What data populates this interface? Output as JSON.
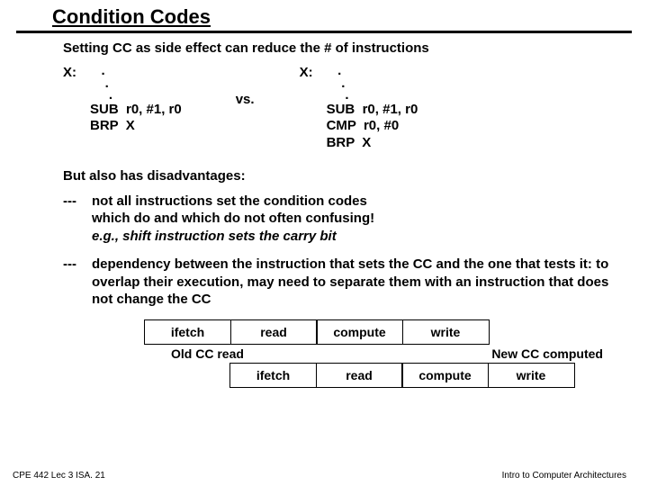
{
  "title": "Condition Codes",
  "intro": "Setting CC as side effect can reduce the # of instructions",
  "left": {
    "label": "X:",
    "dots": "   .\n    .\n     .",
    "code": "SUB  r0, #1, r0\nBRP  X"
  },
  "vs": "vs.",
  "right": {
    "label": "X:",
    "dots": "   .\n    .\n     .",
    "code": "SUB  r0, #1, r0\nCMP  r0, #0\nBRP  X"
  },
  "disadv_head": "But also has disadvantages:",
  "b1": {
    "dash": "---",
    "l1": "not all instructions set the condition codes",
    "l2": "which do and which do not often confusing!",
    "l3": "e.g., shift instruction sets the carry bit"
  },
  "b2": {
    "dash": "---",
    "text": "dependency between the instruction that sets the CC and the one that tests it: to overlap their execution, may need to separate them with an instruction that does not change the CC"
  },
  "stages": {
    "s1": "ifetch",
    "s2": "read",
    "s3": "compute",
    "s4": "write"
  },
  "anno_left": "Old CC read",
  "anno_right": "New CC computed",
  "footer_left": "CPE 442 Lec 3 ISA. 21",
  "footer_right": "Intro to Computer Architectures"
}
